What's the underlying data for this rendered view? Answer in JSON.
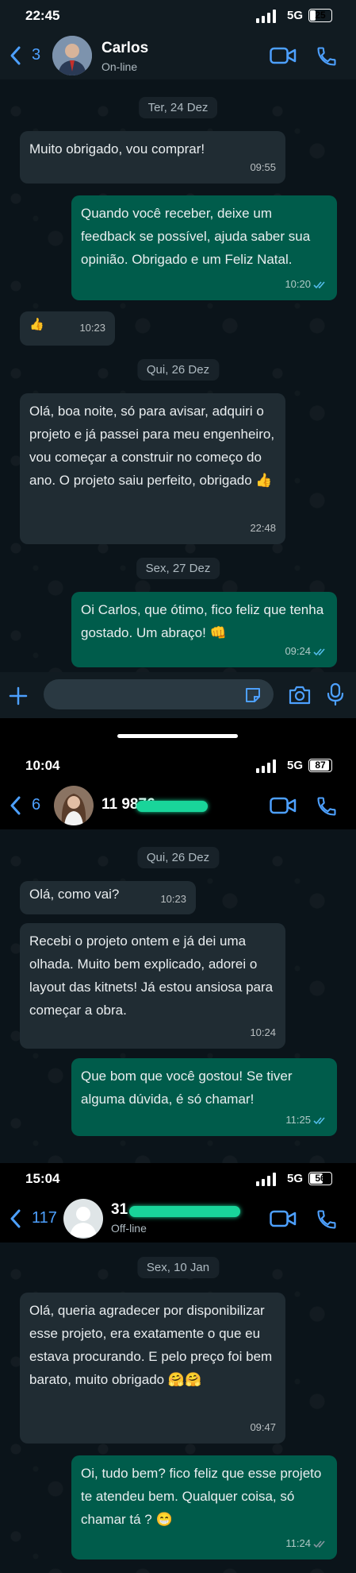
{
  "chats": [
    {
      "status": {
        "time": "22:45",
        "network": "5G",
        "battery": "25",
        "battery_level": 0.25
      },
      "header": {
        "back_count": "3",
        "contact_name": "Carlos",
        "contact_status": "On-line"
      },
      "date_1": "Ter, 24 Dez",
      "m1": {
        "text": "Muito obrigado, vou comprar!",
        "time": "09:55"
      },
      "m2": {
        "text": "Quando você receber, deixe um feedback se possível, ajuda saber sua opinião. Obrigado e um Feliz Natal.",
        "time": "10:20"
      },
      "m3": {
        "text": "👍",
        "time": "10:23"
      },
      "date_2": "Qui, 26 Dez",
      "m4": {
        "text": "Olá, boa noite, só para avisar, adquiri o projeto e já passei para meu engenheiro, vou começar a construir no começo do ano. O projeto saiu perfeito, obrigado 👍",
        "time": "22:48"
      },
      "date_3": "Sex, 27 Dez",
      "m5": {
        "text": "Oi Carlos, que ótimo, fico feliz que tenha gostado. Um abraço! 👊",
        "time": "09:24"
      }
    },
    {
      "status": {
        "time": "10:04",
        "network": "5G",
        "battery": "87",
        "battery_level": 0.87
      },
      "header": {
        "back_count": "6",
        "contact_name": "11 9876"
      },
      "date_1": "Qui, 26 Dez",
      "m1": {
        "text": "Olá, como vai?",
        "time": "10:23"
      },
      "m2": {
        "text": "Recebi o projeto ontem e já dei uma olhada. Muito bem explicado, adorei o layout das kitnets! Já estou ansiosa para começar a obra.",
        "time": "10:24"
      },
      "m3": {
        "text": "Que bom que você gostou! Se tiver alguma dúvida, é só chamar!",
        "time": "11:25"
      }
    },
    {
      "status": {
        "time": "15:04",
        "network": "5G",
        "battery": "56",
        "battery_level": 0.56
      },
      "header": {
        "back_count": "117",
        "contact_name": "31",
        "contact_status": "Off-line"
      },
      "date_1": "Sex, 10 Jan",
      "m1": {
        "text": "Olá, queria agradecer por disponibilizar esse projeto, era exatamente o que eu estava procurando. E pelo preço foi bem barato, muito obrigado 🤗🤗",
        "time": "09:47"
      },
      "m2": {
        "text": "Oi, tudo bem? fico feliz que esse projeto te atendeu bem. Qualquer coisa, só chamar tá ? 😁",
        "time": "11:24"
      }
    }
  ],
  "colors": {
    "accent": "#4da0ff",
    "incoming": "#202c33",
    "outgoing": "#005c4b",
    "read_ticks": "#53bdeb"
  },
  "icons": [
    "back-arrow-icon",
    "video-call-icon",
    "phone-icon",
    "plus-icon",
    "sticker-icon",
    "camera-icon",
    "mic-icon",
    "read-ticks-icon"
  ]
}
